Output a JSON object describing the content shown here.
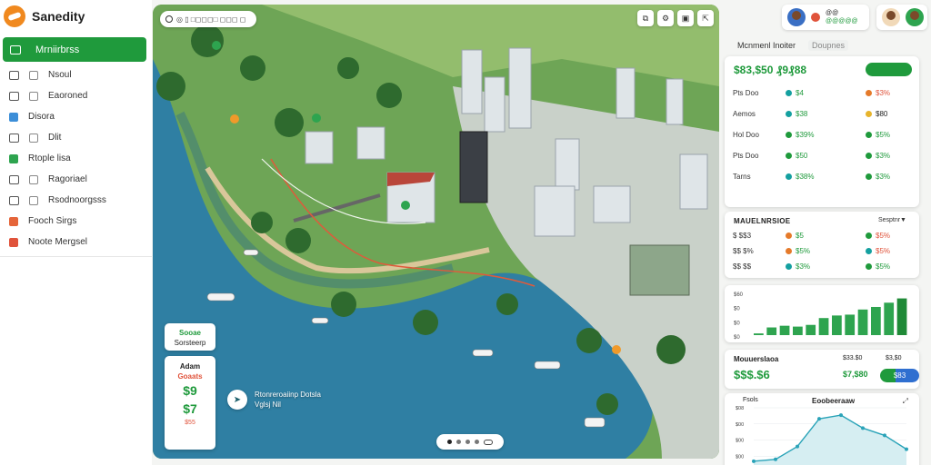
{
  "app": {
    "brand": "Sanedity"
  },
  "sidebar": {
    "active_item": "Mrniirbrss",
    "items": [
      {
        "label": "Nsoul",
        "icon": "box-icon",
        "tone": "plain"
      },
      {
        "label": "Eaoroned",
        "icon": "calendar-icon",
        "tone": "plain"
      },
      {
        "label": "Disora",
        "icon": "home-icon",
        "tone": "blue"
      },
      {
        "label": "Dlit",
        "icon": "document-icon",
        "tone": "plain"
      },
      {
        "label": "Rtople lisa",
        "icon": "map-pin-icon",
        "tone": "green"
      },
      {
        "label": "Ragoriael",
        "icon": "chart-icon",
        "tone": "plain"
      },
      {
        "label": "Rsodnoorgsss",
        "icon": "bell-icon",
        "tone": "plain"
      },
      {
        "label": "Fooch Sirgs",
        "icon": "cloud-icon",
        "tone": "orange"
      },
      {
        "label": "Noote Mergsel",
        "icon": "globe-icon",
        "tone": "red"
      }
    ]
  },
  "map": {
    "search_value": "◎ ▯ □◻◻◻□ ◻◻◻ ◻",
    "tool_icons": [
      "layers-icon",
      "settings-icon",
      "camera-icon",
      "share-icon"
    ],
    "tool_glyphs": [
      "⧉",
      "⚙",
      "▣",
      "⇱"
    ],
    "weather_card_1": {
      "line1": "Sooae",
      "line2": "Sorsteerp"
    },
    "weather_card_2": {
      "title": "Adam",
      "subtitle": "Goaats",
      "value1": "$9",
      "value2": "$7",
      "footer": "$55"
    },
    "poi": {
      "line1": "Rtonreroaiinp Dotsla",
      "line2": "Vglsj Nil"
    }
  },
  "header": {
    "card1": {
      "line1": "@@",
      "line2": "@@@@@"
    }
  },
  "panel": {
    "tabs": [
      "Mcnmenl Inoiter",
      "Doupnes"
    ],
    "summary": {
      "title": "$83,$50 ₰9₰88",
      "button": "",
      "rows": [
        {
          "label": "Pts Doo",
          "mid": "$4",
          "mid_dot": "teal",
          "end": "$3%",
          "end_dot": "orange",
          "tone": "red"
        },
        {
          "label": "Aemos",
          "mid": "$38",
          "mid_dot": "teal",
          "end": "$80",
          "end_dot": "yellow",
          "tone": "plain"
        },
        {
          "label": "Hol Doo",
          "mid": "$39%",
          "mid_dot": "green",
          "end": "$5%",
          "end_dot": "green",
          "tone": "green"
        },
        {
          "label": "Pts Doo",
          "mid": "$50",
          "mid_dot": "green",
          "end": "$3%",
          "end_dot": "green",
          "tone": "green"
        },
        {
          "label": "Tarns",
          "mid": "$38%",
          "mid_dot": "teal",
          "end": "$3%",
          "end_dot": "green",
          "tone": "green"
        }
      ]
    },
    "detail": {
      "title": "MAUELNRSIOE",
      "right": "Sesptnr▼",
      "rows": [
        {
          "label": "$ $$3",
          "mid": "$5",
          "mid_dot": "orange",
          "end": "$5%",
          "end_dot": "green",
          "tone": "red"
        },
        {
          "label": "$$ $%",
          "mid": "$5%",
          "mid_dot": "orange",
          "end": "$5%",
          "end_dot": "teal",
          "tone": "red"
        },
        {
          "label": "$$ $$",
          "mid": "$3%",
          "mid_dot": "teal",
          "end": "$5%",
          "end_dot": "green",
          "tone": "green"
        }
      ]
    },
    "stats": {
      "label1": "Mouuerslaoa",
      "value1": "$$$.$6",
      "label2": "$33.$0",
      "value2": "$7,$80",
      "label3": "$3,$0",
      "button": "$83"
    },
    "line_card": {
      "title": "Eoobeeraaw",
      "y_top": "Fsols"
    }
  },
  "chart_data": [
    {
      "type": "bar",
      "categories": [
        "",
        "",
        "",
        "",
        "",
        "",
        "",
        "",
        "",
        "",
        "",
        ""
      ],
      "values": [
        2,
        9,
        11,
        10,
        12,
        20,
        23,
        24,
        30,
        33,
        38,
        43
      ],
      "y_ticks": [
        "$60",
        "$0",
        "$0",
        "$0"
      ],
      "ylim": [
        0,
        50
      ],
      "color": "#2ea44f"
    },
    {
      "type": "line",
      "x": [
        0,
        1,
        2,
        3,
        4,
        5,
        6,
        7
      ],
      "y": [
        12,
        14,
        28,
        58,
        62,
        48,
        40,
        25
      ],
      "y_ticks": [
        "$08",
        "$00",
        "$00",
        "$00",
        "$00"
      ],
      "x_ticks": [
        "$00",
        "$00",
        "$00",
        "$00",
        "$00",
        "$00",
        "$00"
      ],
      "ylim": [
        0,
        70
      ],
      "color": "#2aa3b8"
    }
  ]
}
